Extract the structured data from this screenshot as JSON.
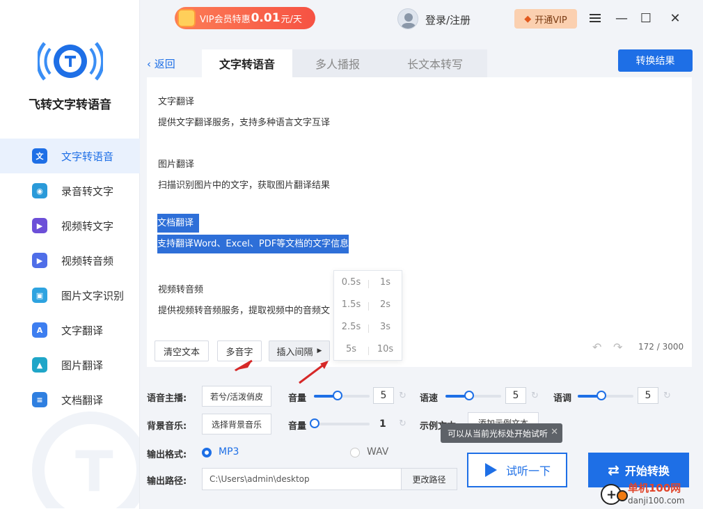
{
  "app": {
    "title": "飞转文字转语音"
  },
  "sidebar": {
    "items": [
      {
        "label": "文字转语音",
        "icon": "text-to-speech-icon",
        "color": "#1e6fe6",
        "glyph": "文"
      },
      {
        "label": "录音转文字",
        "icon": "recording-icon",
        "color": "#2a9ad9",
        "glyph": "◉"
      },
      {
        "label": "视频转文字",
        "icon": "video-text-icon",
        "color": "#6c4fd8",
        "glyph": "▶"
      },
      {
        "label": "视频转音频",
        "icon": "video-audio-icon",
        "color": "#4f6ee8",
        "glyph": "▶"
      },
      {
        "label": "图片文字识别",
        "icon": "ocr-icon",
        "color": "#2ea3e0",
        "glyph": "▣"
      },
      {
        "label": "文字翻译",
        "icon": "text-translate-icon",
        "color": "#3d7ef0",
        "glyph": "A"
      },
      {
        "label": "图片翻译",
        "icon": "image-translate-icon",
        "color": "#1fa6c8",
        "glyph": "▲"
      },
      {
        "label": "文档翻译",
        "icon": "doc-translate-icon",
        "color": "#2f7fe0",
        "glyph": "≡"
      }
    ]
  },
  "topbar": {
    "vip_prefix": "VIP会员特惠",
    "vip_price": "0.01",
    "vip_suffix": "元/天",
    "login": "登录/注册",
    "open_vip": "开通VIP",
    "minimize": "—",
    "maximize": "☐",
    "close": "✕"
  },
  "tabs": {
    "back": "返回",
    "items": [
      "文字转语音",
      "多人播报",
      "长文本转写"
    ],
    "result": "转换结果"
  },
  "editor": {
    "paragraphs": [
      {
        "title": "文字翻译",
        "body": "提供文字翻译服务，支持多种语言文字互译"
      },
      {
        "title": "图片翻译",
        "body": "扫描识别图片中的文字，获取图片翻译结果"
      },
      {
        "title": "文档翻译",
        "body": "支持翻译Word、Excel、PDF等文档的文字信息"
      },
      {
        "title": "视频转音频",
        "body": "提供视频转音频服务，提取视频中的音频文"
      }
    ],
    "clear": "清空文本",
    "polyphone": "多音字",
    "insert_pause": "插入间隔",
    "counter": "172 / 3000",
    "pauses": [
      [
        "0.5s",
        "1s"
      ],
      [
        "1.5s",
        "2s"
      ],
      [
        "2.5s",
        "3s"
      ],
      [
        "5s",
        "10s"
      ]
    ]
  },
  "settings": {
    "voice_label": "语音主播:",
    "voice_value": "若兮/活泼俏皮",
    "volume_label": "音量",
    "volume": "5",
    "speed_label": "语速",
    "speed": "5",
    "pitch_label": "语调",
    "pitch": "5",
    "bgm_label": "背景音乐:",
    "bgm_button": "选择背景音乐",
    "bgm_volume_label": "音量",
    "bgm_volume": "1",
    "sample_label": "示例文本:",
    "sample_button": "添加示例文本",
    "format_label": "输出格式:",
    "format_mp3": "MP3",
    "format_wav": "WAV",
    "path_label": "输出路径:",
    "path_value": "C:\\Users\\admin\\desktop",
    "path_button": "更改路径",
    "tooltip": "可以从当前光标处开始试听",
    "listen": "试听一下",
    "start": "开始转换"
  },
  "watermark": {
    "cn": "单机100网",
    "url": "danji100.com"
  }
}
